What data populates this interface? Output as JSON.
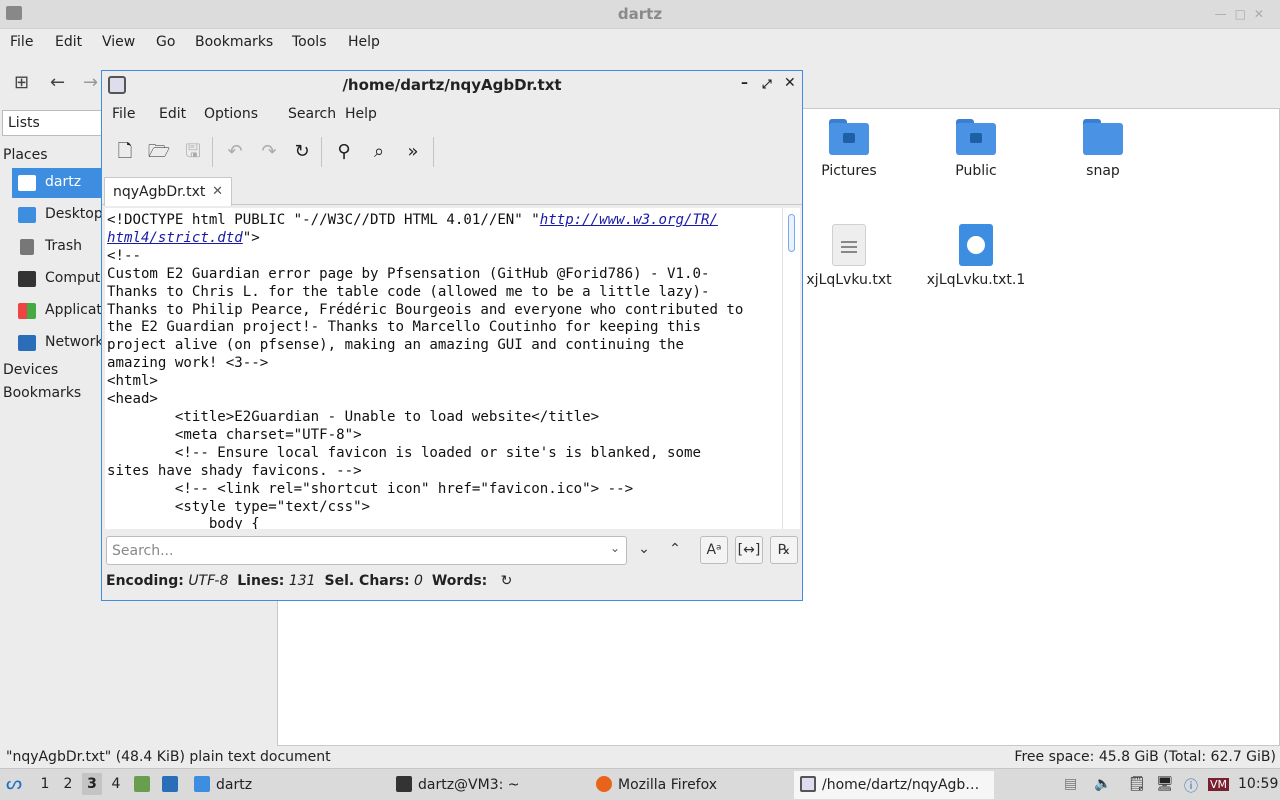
{
  "fm": {
    "title": "dartz",
    "menu": [
      "File",
      "Edit",
      "View",
      "Go",
      "Bookmarks",
      "Tools",
      "Help"
    ],
    "side": {
      "lists_label": "Lists",
      "places_label": "Places",
      "places": [
        "dartz",
        "Desktop",
        "Trash",
        "Computer",
        "Applications",
        "Network"
      ],
      "devices_label": "Devices",
      "bookmarks_label": "Bookmarks"
    },
    "items": [
      "Pictures",
      "Public",
      "snap",
      "xjLqLvku.txt",
      "xjLqLvku.txt.1"
    ],
    "status_left": "\"nqyAgbDr.txt\" (48.4 KiB) plain text document",
    "status_right": "Free space: 45.8 GiB (Total: 62.7 GiB)"
  },
  "editor": {
    "title": "/home/dartz/nqyAgbDr.txt",
    "menu": [
      "File",
      "Edit",
      "Options",
      "Search",
      "Help"
    ],
    "tab_label": "nqyAgbDr.txt",
    "link_text": "http://www.w3.org/TR/\nhtml4/strict.dtd",
    "content_before_link": "<!DOCTYPE html PUBLIC \"-//W3C//DTD HTML 4.01//EN\" \"",
    "content_after_link": "\">\n<!--\nCustom E2 Guardian error page by Pfsensation (GitHub @Forid786) - V1.0-\nThanks to Chris L. for the table code (allowed me to be a little lazy)-\nThanks to Philip Pearce, Frédéric Bourgeois and everyone who contributed to\nthe E2 Guardian project!- Thanks to Marcello Coutinho for keeping this\nproject alive (on pfsense), making an amazing GUI and continuing the\namazing work! <3-->\n<html>\n<head>\n        <title>E2Guardian - Unable to load website</title>\n        <meta charset=\"UTF-8\">\n        <!-- Ensure local favicon is loaded or site's is blanked, some\nsites have shady favicons. -->\n        <!-- <link rel=\"shortcut icon\" href=\"favicon.ico\"> -->\n        <style type=\"text/css\">\n            body {",
    "search_placeholder": "Search...",
    "status": {
      "encoding_label": "Encoding:",
      "encoding_value": "UTF-8",
      "lines_label": "Lines:",
      "lines_value": "131",
      "sel_label": "Sel. Chars:",
      "sel_value": "0",
      "words_label": "Words:"
    }
  },
  "taskbar": {
    "workspaces": [
      "1",
      "2",
      "3",
      "4"
    ],
    "current_workspace": "3",
    "tasks": [
      "dartz",
      "dartz@VM3: ~",
      "Mozilla Firefox",
      "/home/dartz/nqyAgb…"
    ],
    "clock": "10:59"
  }
}
